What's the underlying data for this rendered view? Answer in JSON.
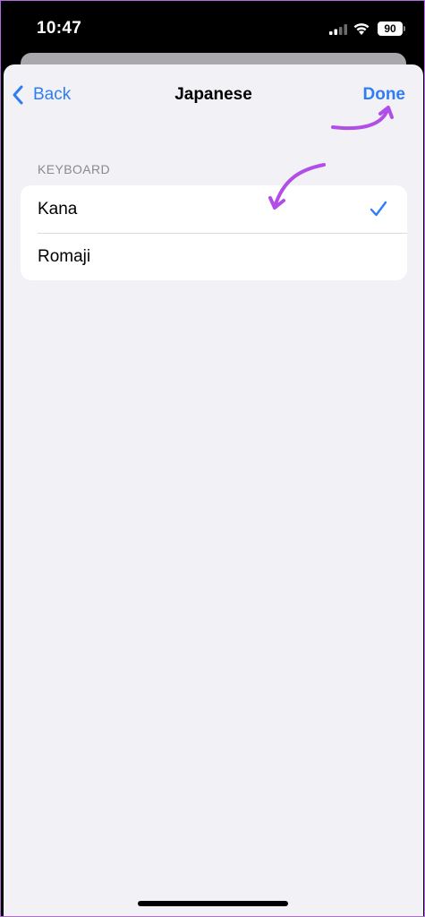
{
  "status_bar": {
    "time": "10:47",
    "battery": "90",
    "icons": [
      "cellular-signal-icon",
      "wifi-icon",
      "battery-icon"
    ]
  },
  "nav": {
    "back_label": "Back",
    "title": "Japanese",
    "done_label": "Done"
  },
  "section": {
    "header": "KEYBOARD",
    "options": [
      {
        "label": "Kana",
        "selected": true
      },
      {
        "label": "Romaji",
        "selected": false
      }
    ]
  },
  "colors": {
    "accent": "#2f7df6",
    "annotation_arrow": "#b14ee8",
    "background": "#f2f1f6"
  }
}
